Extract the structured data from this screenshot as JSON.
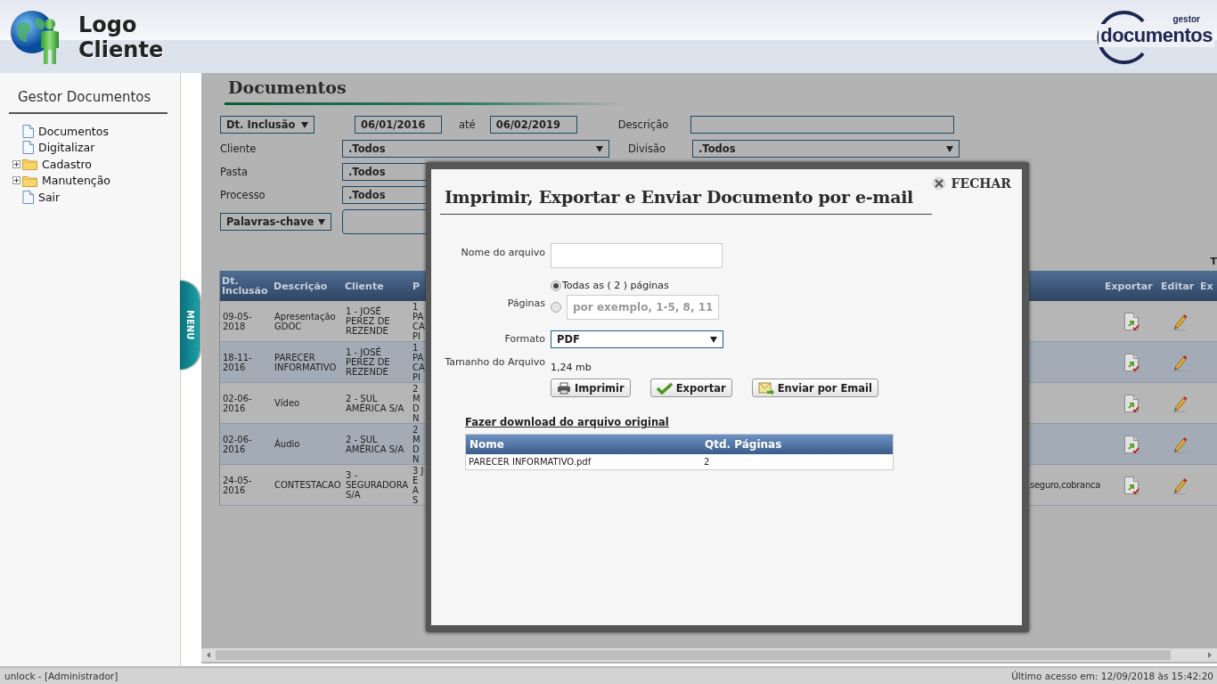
{
  "header": {
    "logo_text": "Logo Cliente",
    "brand_small": "gestor",
    "brand_name": "documentos"
  },
  "sidebar": {
    "title": "Gestor Documentos",
    "items": [
      {
        "label": "Documentos",
        "kind": "page"
      },
      {
        "label": "Digitalizar",
        "kind": "page"
      },
      {
        "label": "Cadastro",
        "kind": "folder",
        "expanded": false
      },
      {
        "label": "Manutenção",
        "kind": "folder",
        "expanded": false
      },
      {
        "label": "Sair",
        "kind": "page"
      }
    ]
  },
  "menu_tab": {
    "label": "MENU"
  },
  "page_title": "Documentos",
  "filters": {
    "date_field": "Dt. Inclusão",
    "date_from": "06/01/2016",
    "date_to_label": "até",
    "date_to": "06/02/2019",
    "description_label": "Descrição",
    "cliente": {
      "label": "Cliente",
      "value": ".Todos"
    },
    "divisao": {
      "label": "Divisão",
      "value": ".Todos"
    },
    "pasta": {
      "label": "Pasta",
      "value": ".Todos"
    },
    "processo": {
      "label": "Processo",
      "value": ".Todos"
    },
    "keyword_field": "Palavras-chave"
  },
  "cut_label": "T",
  "table": {
    "columns": [
      "Dt. Inclusão",
      "Descrição",
      "Cliente",
      "P",
      "Exportar",
      "Editar",
      "Ex"
    ],
    "rows": [
      {
        "cells": [
          "09-05-2018",
          "Apresentação GDOC",
          "1 - JOSÉ PEREZ DE REZENDE",
          "1 PA CA PI"
        ]
      },
      {
        "cells": [
          "18-11-2016",
          "PARECER INFORMATIVO",
          "1 - JOSÉ PEREZ DE REZENDE",
          "1 PA CA PI"
        ]
      },
      {
        "cells": [
          "02-06-2016",
          "Vídeo",
          "2 - SUL AMÉRICA S/A",
          "2 M D N"
        ]
      },
      {
        "cells": [
          "02-06-2016",
          "Áudio",
          "2 - SUL AMÉRICA S/A",
          "2 M D N"
        ]
      },
      {
        "cells": [
          "24-05-2016",
          "CONTESTACAO",
          "3 - SEGURADORA S/A",
          "3 JE A S"
        ],
        "column_5": ",seguro,cobranca"
      }
    ]
  },
  "dialog": {
    "title": "Imprimir, Exportar e Enviar Documento por e-mail",
    "close_label": "FECHAR",
    "file_name": {
      "label": "Nome do arquivo"
    },
    "pages": {
      "label": "Páginas",
      "options": [
        {
          "kind": "all",
          "label": "Todas as ( 2 ) páginas",
          "selected": true
        },
        {
          "kind": "range",
          "placeholder": "por exemplo, 1-5, 8, 11",
          "selected": false
        }
      ]
    },
    "format": {
      "label": "Formato",
      "value": "PDF"
    },
    "size": {
      "label": "Tamanho do Arquivo",
      "value": "1,24 mb"
    },
    "buttons": [
      {
        "kind": "print",
        "label": "Imprimir"
      },
      {
        "kind": "export",
        "label": "Exportar"
      },
      {
        "kind": "email",
        "label": "Enviar por Email"
      }
    ],
    "download_link": "Fazer download do arquivo original",
    "files": {
      "columns": [
        "Nome",
        "Qtd. Páginas"
      ],
      "rows": [
        [
          "PARECER INFORMATIVO.pdf",
          "2"
        ]
      ]
    }
  },
  "status_bar": {
    "user": "unlock - [Administrador]",
    "last_access": "Último acesso em: 12/09/2018  às 15:42:20"
  }
}
